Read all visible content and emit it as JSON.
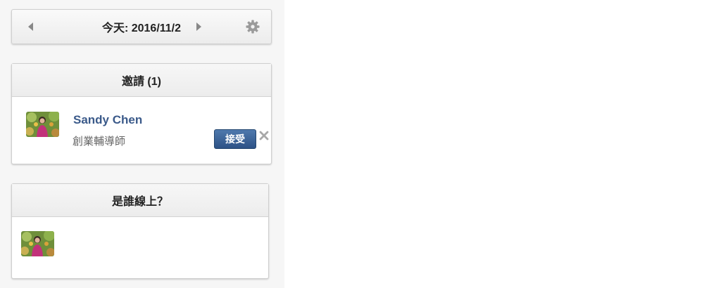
{
  "date_bar": {
    "label": "今天: 2016/11/2",
    "prev_icon": "caret-left-icon",
    "next_icon": "caret-right-icon",
    "settings_icon": "gear-icon"
  },
  "invites": {
    "title": "邀請 (1)",
    "items": [
      {
        "name": "Sandy Chen",
        "title": "創業輔導師",
        "accept_label": "接受",
        "dismiss_icon": "close-icon"
      }
    ]
  },
  "online": {
    "title": "是誰線上？"
  },
  "colors": {
    "link": "#3b5a8a",
    "button": "#2d5286",
    "panel_header": "#ececec"
  }
}
